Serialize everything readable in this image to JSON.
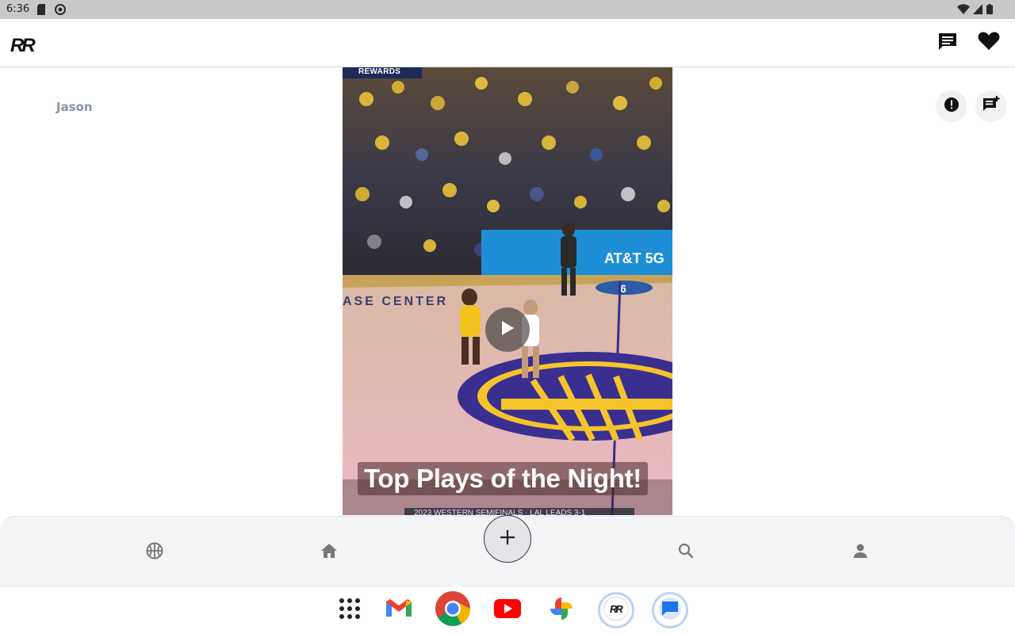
{
  "status_bar": {
    "time": "6:36",
    "left_icons": [
      "sd-card-icon",
      "vpn-icon"
    ],
    "right_icons": [
      "wifi-icon",
      "signal-icon",
      "battery-icon"
    ]
  },
  "header": {
    "logo_text": "RR",
    "actions": [
      {
        "name": "messages",
        "icon": "chat-icon"
      },
      {
        "name": "favorites",
        "icon": "heart-icon"
      }
    ]
  },
  "post": {
    "author": "Jason",
    "actions": [
      {
        "name": "report",
        "icon": "alert-icon"
      },
      {
        "name": "comments",
        "icon": "comment-list-icon"
      }
    ],
    "video": {
      "caption": "Top Plays of the Night!",
      "overlay_rewards": "REWARDS",
      "overlay_sponsor": "AT&T 5G",
      "overlay_court": "ASE CENTER",
      "overlay_number": "6",
      "overlay_lower_third": "2023 WESTERN SEMIFINALS · LAL LEADS 3-1"
    }
  },
  "bottom_nav": [
    {
      "name": "explore",
      "icon": "basketball-icon"
    },
    {
      "name": "home",
      "icon": "home-icon"
    },
    {
      "name": "create",
      "icon": "plus-icon"
    },
    {
      "name": "search",
      "icon": "search-icon"
    },
    {
      "name": "profile",
      "icon": "person-icon"
    }
  ],
  "dock": [
    {
      "name": "app-drawer",
      "icon": "grid-dots-icon"
    },
    {
      "name": "gmail",
      "icon": "gmail-icon"
    },
    {
      "name": "chrome",
      "icon": "chrome-icon"
    },
    {
      "name": "youtube",
      "icon": "youtube-icon"
    },
    {
      "name": "photos",
      "icon": "photos-icon"
    },
    {
      "name": "rr-app",
      "icon": "rr-app-icon"
    },
    {
      "name": "messages",
      "icon": "messages-icon"
    }
  ],
  "colors": {
    "status_bar": "#c8c8c8",
    "nav_background": "#f2f4f6",
    "author_text": "#8a94a0",
    "court_purple": "#3a2f8f",
    "court_gold": "#f5c32b"
  }
}
